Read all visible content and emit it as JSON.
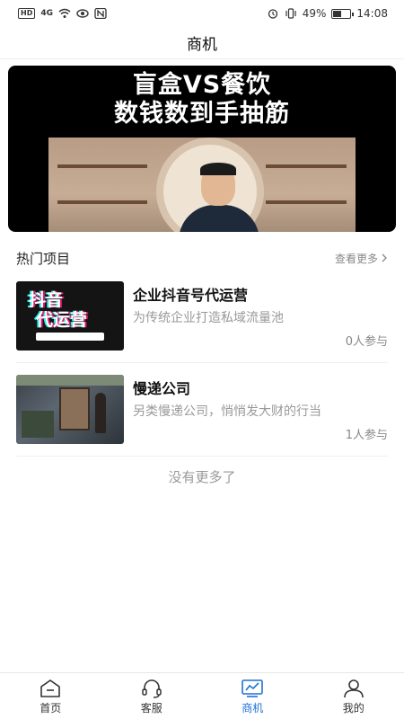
{
  "status_bar": {
    "carrier_chip": "HD",
    "signal": "4G",
    "battery": "49%",
    "battery_level": 0.49,
    "time": "14:08"
  },
  "header": {
    "title": "商机"
  },
  "banner": {
    "line1": "盲盒VS餐饮",
    "line2": "数钱数到手抽筋"
  },
  "section": {
    "title": "热门项目",
    "more_label": "查看更多"
  },
  "projects": [
    {
      "name": "企业抖音号代运营",
      "description": "为传统企业打造私域流量池",
      "participants": "0人参与",
      "thumb_text_top": "抖音",
      "thumb_text_mid": "代运营"
    },
    {
      "name": "慢递公司",
      "description": "另类慢递公司，悄悄发大财的行当",
      "participants": "1人参与"
    }
  ],
  "no_more": "没有更多了",
  "tabs": [
    {
      "label": "首页",
      "icon": "home-icon",
      "active": false
    },
    {
      "label": "客服",
      "icon": "headset-icon",
      "active": false
    },
    {
      "label": "商机",
      "icon": "chart-icon",
      "active": true
    },
    {
      "label": "我的",
      "icon": "user-icon",
      "active": false
    }
  ],
  "colors": {
    "accent": "#1f6fd8",
    "muted": "#999999"
  }
}
